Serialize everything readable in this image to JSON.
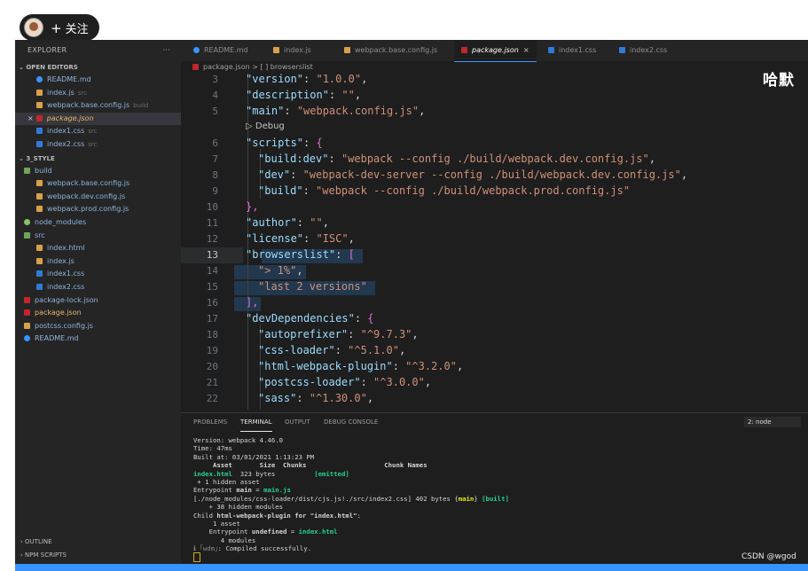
{
  "follow": {
    "label": "关注",
    "plus": "+"
  },
  "watermark": "CSDN @wgod",
  "overlay_text": "哈默",
  "explorer": {
    "title": "EXPLORER",
    "dots": "···",
    "open_editors_label": "OPEN EDITORS",
    "open_editors": [
      {
        "name": "README.md",
        "desc": "",
        "icon": "info"
      },
      {
        "name": "index.js",
        "desc": "src",
        "icon": "js"
      },
      {
        "name": "webpack.base.config.js",
        "desc": "build",
        "icon": "js"
      },
      {
        "name": "package.json",
        "desc": "",
        "icon": "pkg"
      },
      {
        "name": "index1.css",
        "desc": "src",
        "icon": "css"
      },
      {
        "name": "index2.css",
        "desc": "src",
        "icon": "css"
      }
    ],
    "close_mark": "×",
    "project_label": "3_STYLE",
    "tree": [
      {
        "name": "build",
        "icon": "folder"
      },
      {
        "name": "webpack.base.config.js",
        "icon": "js"
      },
      {
        "name": "webpack.dev.config.js",
        "icon": "js"
      },
      {
        "name": "webpack.prod.config.js",
        "icon": "js"
      },
      {
        "name": "node_modules",
        "icon": "nm"
      },
      {
        "name": "src",
        "icon": "folder"
      },
      {
        "name": "index.html",
        "icon": "js"
      },
      {
        "name": "index.js",
        "icon": "js"
      },
      {
        "name": "index1.css",
        "icon": "css"
      },
      {
        "name": "index2.css",
        "icon": "css"
      },
      {
        "name": "package-lock.json",
        "icon": "pkg"
      },
      {
        "name": "package.json",
        "icon": "pkg"
      },
      {
        "name": "postcss.config.js",
        "icon": "js"
      },
      {
        "name": "README.md",
        "icon": "info"
      }
    ],
    "outline_label": "OUTLINE",
    "npm_label": "NPM SCRIPTS"
  },
  "tabs": [
    {
      "label": "README.md"
    },
    {
      "label": "index.js"
    },
    {
      "label": "webpack.base.config.js"
    },
    {
      "label": "package.json"
    },
    {
      "label": "index1.css"
    },
    {
      "label": "index2.css"
    }
  ],
  "tab_close": "×",
  "breadcrumb": {
    "file": "package.json",
    "sep": ">",
    "symbol": "[ ] browserslist"
  },
  "editor": {
    "line_numbers": [
      "3",
      "4",
      "5",
      "6",
      "7",
      "8",
      "9",
      "10",
      "11",
      "12",
      "13",
      "14",
      "15",
      "16",
      "17",
      "18",
      "19",
      "20",
      "21",
      "22"
    ],
    "current_line": "13",
    "debug_lens": "▷ Debug",
    "lines": {
      "l3": [
        "\"version\"",
        ": ",
        "\"1.0.0\"",
        ","
      ],
      "l4": [
        "\"description\"",
        ": ",
        "\"\"",
        ","
      ],
      "l5": [
        "\"main\"",
        ": ",
        "\"webpack.config.js\"",
        ","
      ],
      "l6": [
        "\"scripts\"",
        ": ",
        "{"
      ],
      "l7": [
        "\"build:dev\"",
        ": ",
        "\"webpack --config ./build/webpack.dev.config.js\"",
        ","
      ],
      "l8": [
        "\"dev\"",
        ": ",
        "\"webpack-dev-server --config ./build/webpack.dev.config.js\"",
        ","
      ],
      "l9": [
        "\"build\"",
        ": ",
        "\"webpack --config ./build/webpack.prod.config.js\""
      ],
      "l10": [
        "},"
      ],
      "l11": [
        "\"author\"",
        ": ",
        "\"\"",
        ","
      ],
      "l12": [
        "\"license\"",
        ": ",
        "\"ISC\"",
        ","
      ],
      "l13": [
        "\"browserslist\"",
        ": ",
        "["
      ],
      "l14": [
        "\"> 1%\"",
        ","
      ],
      "l15": [
        "\"last 2 versions\""
      ],
      "l16": [
        "],"
      ],
      "l17": [
        "\"devDependencies\"",
        ": ",
        "{"
      ],
      "l18": [
        "\"autoprefixer\"",
        ": ",
        "\"^9.7.3\"",
        ","
      ],
      "l19": [
        "\"css-loader\"",
        ": ",
        "\"^5.1.0\"",
        ","
      ],
      "l20": [
        "\"html-webpack-plugin\"",
        ": ",
        "\"^3.2.0\"",
        ","
      ],
      "l21": [
        "\"postcss-loader\"",
        ": ",
        "\"^3.0.0\"",
        ","
      ],
      "l22": [
        "\"sass\"",
        ": ",
        "\"^1.30.0\"",
        ","
      ]
    }
  },
  "panel": {
    "tabs": [
      "PROBLEMS",
      "TERMINAL",
      "OUTPUT",
      "DEBUG CONSOLE"
    ],
    "terminal_select": "2: node",
    "terminal": {
      "t1": "Version: webpack 4.46.0",
      "t2": "Time: 47ms",
      "t3": "Built at: 03/01/2021 1:13:23 PM",
      "t4": "     Asset       Size  Chunks                    Chunk Names",
      "t5a": "index.html",
      "t5b": "  323 bytes",
      "t5c": "[emitted]",
      "t6": " + 1 hidden asset",
      "t7a": "Entrypoint ",
      "t7b": "main",
      "t7c": " = ",
      "t7d": "main.js",
      "t8a": "[./node_modules/css-loader/dist/cjs.js!./src/index2.css] 402 bytes {",
      "t8b": "main",
      "t8c": "} ",
      "t8d": "[built]",
      "t9": "    + 38 hidden modules",
      "t10a": "Child ",
      "t10b": "html-webpack-plugin for \"index.html\"",
      "t10c": ":",
      "t11": "     1 asset",
      "t12a": "    Entrypoint ",
      "t12b": "undefined",
      "t12c": " = ",
      "t12d": "index.html",
      "t13": "       4 modules",
      "t14a": "ℹ ｢wdm｣",
      "t14b": ": Compiled successfully."
    }
  },
  "colors": {
    "accent": "#3794ff",
    "string": "#ce9178",
    "key": "#9cdcfe",
    "editor_bg": "#1e1e1e"
  }
}
